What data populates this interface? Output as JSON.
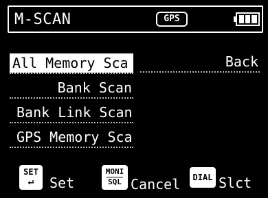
{
  "header": {
    "title": "M-SCAN",
    "gps_badge": "GPS",
    "battery_icon": "battery-full-icon"
  },
  "menu": {
    "items": [
      {
        "label": "All Memory Sca",
        "selected": true
      },
      {
        "label": "Bank Scan",
        "selected": false
      },
      {
        "label": "Bank Link Scan",
        "selected": false
      },
      {
        "label": "GPS Memory Sca",
        "selected": false
      }
    ],
    "back_label": "Back"
  },
  "softkeys": {
    "set": {
      "key_top": "SET",
      "key_arrow": "↵",
      "label": "Set"
    },
    "moni": {
      "key_top": "MONI",
      "key_bottom": "SQL",
      "label": "Cancel"
    },
    "dial": {
      "key": "DIAL",
      "label": "Slct"
    }
  },
  "colors": {
    "background": "#000000",
    "foreground": "#ffffff",
    "highlight_text": "#000000"
  }
}
